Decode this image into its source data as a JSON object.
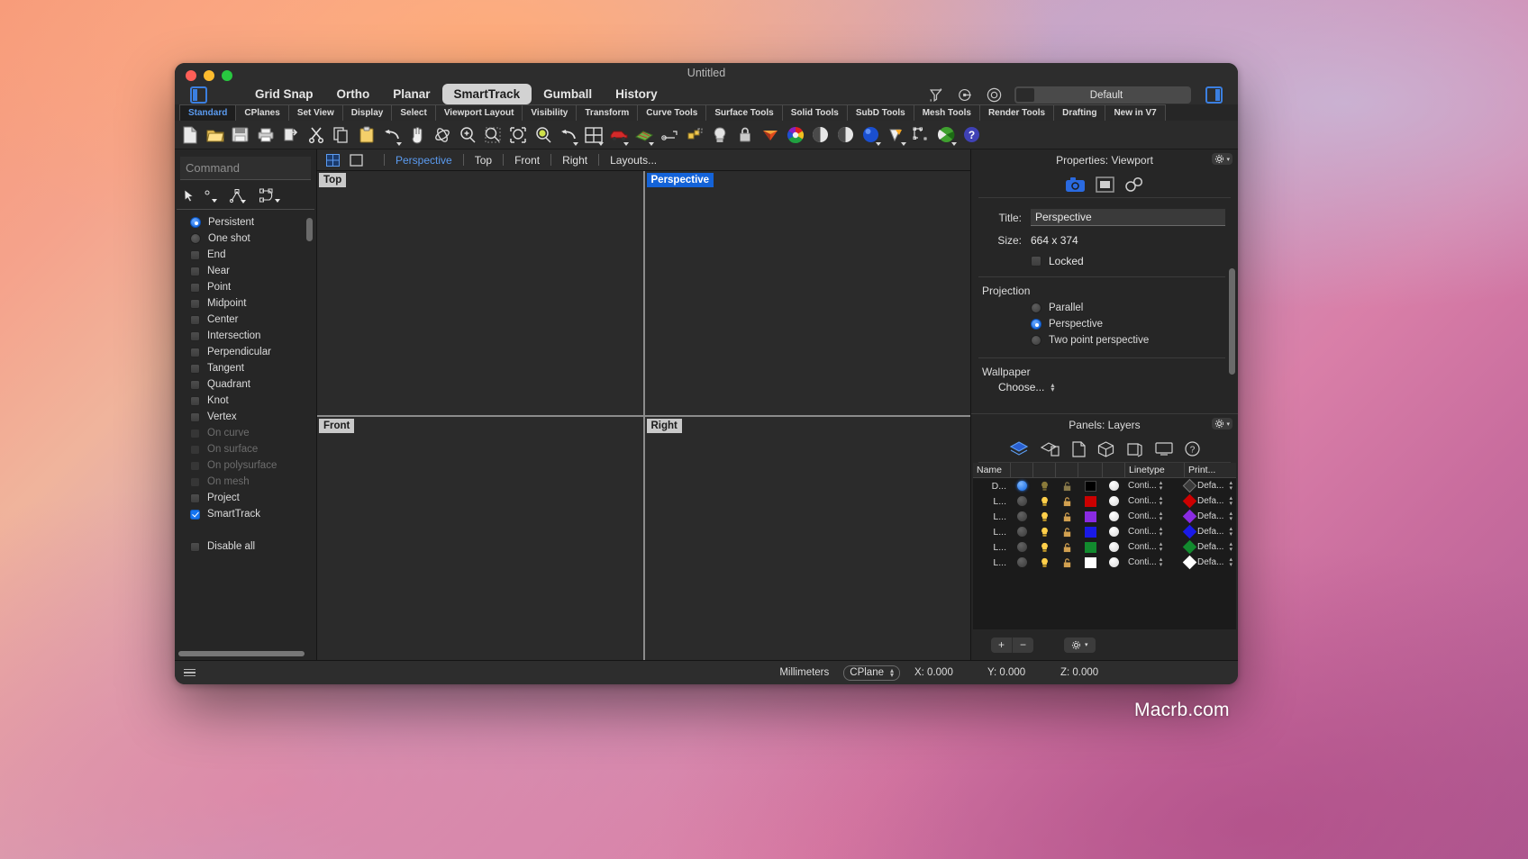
{
  "window": {
    "title": "Untitled",
    "traffic_lights": [
      "close",
      "minimize",
      "zoom"
    ]
  },
  "titlebar": {
    "left_panel_icon": "left-sidebar-icon",
    "right_panel_icon": "right-sidebar-icon",
    "toggles": [
      {
        "label": "Grid Snap",
        "active": false
      },
      {
        "label": "Ortho",
        "active": false
      },
      {
        "label": "Planar",
        "active": false
      },
      {
        "label": "SmartTrack",
        "active": true
      },
      {
        "label": "Gumball",
        "active": false
      },
      {
        "label": "History",
        "active": false
      }
    ],
    "right_icons": [
      "filter-icon",
      "record-history-icon",
      "target-icon"
    ],
    "material_selector": {
      "label": "Default",
      "swatch_color": "#2b2b2b"
    }
  },
  "toolbar_tabs": [
    {
      "label": "Standard",
      "active": true
    },
    {
      "label": "CPlanes",
      "active": false
    },
    {
      "label": "Set View",
      "active": false
    },
    {
      "label": "Display",
      "active": false
    },
    {
      "label": "Select",
      "active": false
    },
    {
      "label": "Viewport Layout",
      "active": false
    },
    {
      "label": "Visibility",
      "active": false
    },
    {
      "label": "Transform",
      "active": false
    },
    {
      "label": "Curve Tools",
      "active": false
    },
    {
      "label": "Surface Tools",
      "active": false
    },
    {
      "label": "Solid Tools",
      "active": false
    },
    {
      "label": "SubD Tools",
      "active": false
    },
    {
      "label": "Mesh Tools",
      "active": false
    },
    {
      "label": "Render Tools",
      "active": false
    },
    {
      "label": "Drafting",
      "active": false
    },
    {
      "label": "New in V7",
      "active": false
    }
  ],
  "icon_toolbar": [
    {
      "name": "new-file-icon"
    },
    {
      "name": "open-folder-icon"
    },
    {
      "name": "save-icon"
    },
    {
      "name": "print-icon"
    },
    {
      "name": "import-icon"
    },
    {
      "name": "cut-icon"
    },
    {
      "name": "copy-icon"
    },
    {
      "name": "paste-icon"
    },
    {
      "name": "undo-icon",
      "arrow": true
    },
    {
      "name": "pan-hand-icon"
    },
    {
      "name": "rotate-view-icon"
    },
    {
      "name": "zoom-in-icon"
    },
    {
      "name": "zoom-window-icon"
    },
    {
      "name": "zoom-extents-icon"
    },
    {
      "name": "zoom-selected-icon"
    },
    {
      "name": "undo-view-icon",
      "arrow": true
    },
    {
      "name": "four-viewport-icon",
      "arrow": true
    },
    {
      "name": "render-car-icon",
      "arrow": true
    },
    {
      "name": "mesh-render-icon",
      "arrow": true
    },
    {
      "name": "dimension-icon",
      "arrow": true
    },
    {
      "name": "block-icon",
      "arrow": true
    },
    {
      "name": "light-bulb-icon",
      "arrow": true
    },
    {
      "name": "lock-icon"
    },
    {
      "name": "material-cone-icon"
    },
    {
      "name": "color-wheel-icon"
    },
    {
      "name": "shade-sphere-icon"
    },
    {
      "name": "shade-sphere2-icon"
    },
    {
      "name": "environment-sphere-icon",
      "arrow": true
    },
    {
      "name": "sun-icon",
      "arrow": true
    },
    {
      "name": "layout-detail-icon"
    },
    {
      "name": "render-preview-icon",
      "arrow": true
    },
    {
      "name": "help-icon"
    }
  ],
  "command_panel": {
    "placeholder": "Command",
    "value": "",
    "osnap_tool_icons": [
      "cursor-icon",
      "point-osnap-icon",
      "curve-osnap-icon",
      "surface-osnap-icon"
    ],
    "options": [
      {
        "label": "Persistent",
        "type": "radio",
        "checked": true,
        "disabled": false
      },
      {
        "label": "One shot",
        "type": "radio",
        "checked": false,
        "disabled": false
      },
      {
        "label": "End",
        "type": "checkbox",
        "checked": false,
        "disabled": false
      },
      {
        "label": "Near",
        "type": "checkbox",
        "checked": false,
        "disabled": false
      },
      {
        "label": "Point",
        "type": "checkbox",
        "checked": false,
        "disabled": false
      },
      {
        "label": "Midpoint",
        "type": "checkbox",
        "checked": false,
        "disabled": false
      },
      {
        "label": "Center",
        "type": "checkbox",
        "checked": false,
        "disabled": false
      },
      {
        "label": "Intersection",
        "type": "checkbox",
        "checked": false,
        "disabled": false
      },
      {
        "label": "Perpendicular",
        "type": "checkbox",
        "checked": false,
        "disabled": false
      },
      {
        "label": "Tangent",
        "type": "checkbox",
        "checked": false,
        "disabled": false
      },
      {
        "label": "Quadrant",
        "type": "checkbox",
        "checked": false,
        "disabled": false
      },
      {
        "label": "Knot",
        "type": "checkbox",
        "checked": false,
        "disabled": false
      },
      {
        "label": "Vertex",
        "type": "checkbox",
        "checked": false,
        "disabled": false
      },
      {
        "label": "On curve",
        "type": "checkbox",
        "checked": false,
        "disabled": true
      },
      {
        "label": "On surface",
        "type": "checkbox",
        "checked": false,
        "disabled": true
      },
      {
        "label": "On polysurface",
        "type": "checkbox",
        "checked": false,
        "disabled": true
      },
      {
        "label": "On mesh",
        "type": "checkbox",
        "checked": false,
        "disabled": true
      },
      {
        "label": "Project",
        "type": "checkbox",
        "checked": false,
        "disabled": false
      },
      {
        "label": "SmartTrack",
        "type": "checkbox",
        "checked": true,
        "disabled": false
      }
    ],
    "disable_all": {
      "label": "Disable all",
      "checked": false
    }
  },
  "viewport_bar": {
    "layout_icons": [
      "four-view-icon",
      "single-view-icon"
    ],
    "tabs": [
      {
        "label": "Perspective",
        "active": true
      },
      {
        "label": "Top",
        "active": false
      },
      {
        "label": "Front",
        "active": false
      },
      {
        "label": "Right",
        "active": false
      },
      {
        "label": "Layouts...",
        "active": false
      }
    ]
  },
  "viewports": [
    {
      "label": "Top",
      "selected": false
    },
    {
      "label": "Perspective",
      "selected": true
    },
    {
      "label": "Front",
      "selected": false
    },
    {
      "label": "Right",
      "selected": false
    }
  ],
  "properties": {
    "header": "Properties: Viewport",
    "gear_icon": "gear-icon",
    "tab_icons": [
      "camera-icon",
      "viewport-icon",
      "link-icon"
    ],
    "title_label": "Title:",
    "title_value": "Perspective",
    "size_label": "Size:",
    "size_value": "664 x 374",
    "locked_label": "Locked",
    "locked_checked": false,
    "projection_label": "Projection",
    "projection_options": [
      {
        "label": "Parallel",
        "checked": false
      },
      {
        "label": "Perspective",
        "checked": true
      },
      {
        "label": "Two point perspective",
        "checked": false
      }
    ],
    "wallpaper_label": "Wallpaper",
    "wallpaper_choose": "Choose..."
  },
  "layers": {
    "header": "Panels: Layers",
    "gear_icon": "gear-icon",
    "tab_icons": [
      "layers-icon",
      "materials-icon",
      "properties-page-icon",
      "object-icon",
      "display-icon",
      "monitor-icon",
      "help-icon"
    ],
    "columns": [
      "Name",
      "",
      "",
      "",
      "",
      "Linetype",
      "Print..."
    ],
    "rows": [
      {
        "name": "D...",
        "current": true,
        "light_on": false,
        "unlocked": true,
        "color": "#000000",
        "material": "#ffffff",
        "linetype": "Conti...",
        "print": "Defa...",
        "print_color": "#3a3a3a"
      },
      {
        "name": "L...",
        "current": false,
        "light_on": true,
        "unlocked": true,
        "color": "#cc0000",
        "material": "#ffffff",
        "linetype": "Conti...",
        "print": "Defa...",
        "print_color": "#cc0000"
      },
      {
        "name": "L...",
        "current": false,
        "light_on": true,
        "unlocked": true,
        "color": "#8a2be2",
        "material": "#ffffff",
        "linetype": "Conti...",
        "print": "Defa...",
        "print_color": "#8a2be2"
      },
      {
        "name": "L...",
        "current": false,
        "light_on": true,
        "unlocked": true,
        "color": "#1a1ae6",
        "material": "#ffffff",
        "linetype": "Conti...",
        "print": "Defa...",
        "print_color": "#1a1ae6"
      },
      {
        "name": "L...",
        "current": false,
        "light_on": true,
        "unlocked": true,
        "color": "#128a2e",
        "material": "#ffffff",
        "linetype": "Conti...",
        "print": "Defa...",
        "print_color": "#128a2e"
      },
      {
        "name": "L...",
        "current": false,
        "light_on": true,
        "unlocked": true,
        "color": "#ffffff",
        "material": "#ffffff",
        "linetype": "Conti...",
        "print": "Defa...",
        "print_color": "#ffffff"
      }
    ],
    "footer": {
      "add_label": "+",
      "remove_label": "−",
      "options_icon": "gear-dropdown-icon"
    }
  },
  "statusbar": {
    "menu_icon": "hamburger-icon",
    "units": "Millimeters",
    "cplane": "CPlane",
    "x": "X: 0.000",
    "y": "Y: 0.000",
    "z": "Z: 0.000"
  },
  "watermark": "Macrb.com"
}
